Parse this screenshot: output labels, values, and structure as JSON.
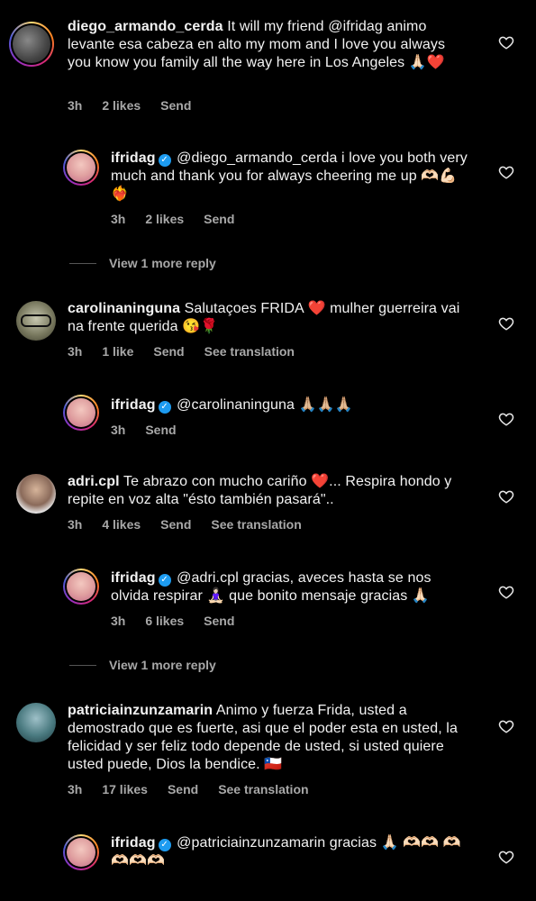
{
  "comments": [
    {
      "username": "diego_armando_cerda",
      "text": "It will my friend @ifridag animo levante esa cabeza en alto my mom and I love you always you know you family all the way here in Los Angeles 🙏🏻❤️",
      "time": "3h",
      "likes": "2 likes",
      "reply": "Send"
    },
    {
      "username": "ifridag",
      "text": "@diego_armando_cerda i love you both very much and thank you for always cheering me up 🫶🏻💪🏻❤️‍🔥",
      "time": "3h",
      "likes": "2 likes",
      "reply": "Send"
    },
    {
      "username": "carolinaninguna",
      "text": "Salutaçoes FRIDA ❤️ mulher guerreira vai na frente querida 😘🌹",
      "time": "3h",
      "likes": "1 like",
      "reply": "Send",
      "translate": "See translation"
    },
    {
      "username": "ifridag",
      "text": "@carolinaninguna 🙏🏼🙏🏼🙏🏼",
      "time": "3h",
      "reply": "Send"
    },
    {
      "username": "adri.cpl",
      "text": "Te abrazo con mucho cariño ❤️... Respira hondo y repite en voz alta \"ésto también pasará\"..",
      "time": "3h",
      "likes": "4 likes",
      "reply": "Send",
      "translate": "See translation"
    },
    {
      "username": "ifridag",
      "text": "@adri.cpl gracias, aveces hasta se nos olvida respirar 🧘🏻‍♀️ que bonito mensaje gracias 🙏🏻",
      "time": "3h",
      "likes": "6 likes",
      "reply": "Send"
    },
    {
      "username": "patriciainzunzamarin",
      "text": "Animo y fuerza Frida, usted a demostrado que es fuerte, asi que el poder esta en usted, la felicidad y ser feliz todo depende de usted,  si usted quiere usted puede, Dios la bendice. 🇨🇱",
      "time": "3h",
      "likes": "17 likes",
      "reply": "Send",
      "translate": "See translation"
    },
    {
      "username": "ifridag",
      "text": "@patriciainzunzamarin gracias 🙏🏻 🫶🏻🫶🏻 🫶🏻🫶🏻🫶🏻🫶🏻"
    }
  ],
  "view_more_1": "View 1 more reply",
  "view_more_2": "View 1 more reply",
  "colors": {
    "background": "#000000",
    "text": "#f2f2f2",
    "meta": "#a8a8a8",
    "verified": "#1d9bf0"
  }
}
